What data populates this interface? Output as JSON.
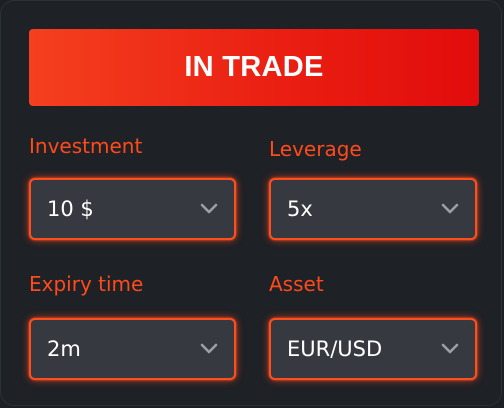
{
  "trade_button": {
    "label": "IN TRADE"
  },
  "fields": {
    "investment": {
      "label": "Investment",
      "value": "10 $"
    },
    "leverage": {
      "label": "Leverage",
      "value": "5x"
    },
    "expiry_time": {
      "label": "Expiry time",
      "value": "2m"
    },
    "asset": {
      "label": "Asset",
      "value": "EUR/USD"
    }
  },
  "colors": {
    "accent": "#ff4a1c",
    "button_gradient_start": "#f4401f",
    "button_gradient_end": "#e10c0c",
    "panel_background": "#1e2126",
    "field_background": "#363a40"
  },
  "icons": {
    "dropdown": "chevron-down-icon"
  }
}
